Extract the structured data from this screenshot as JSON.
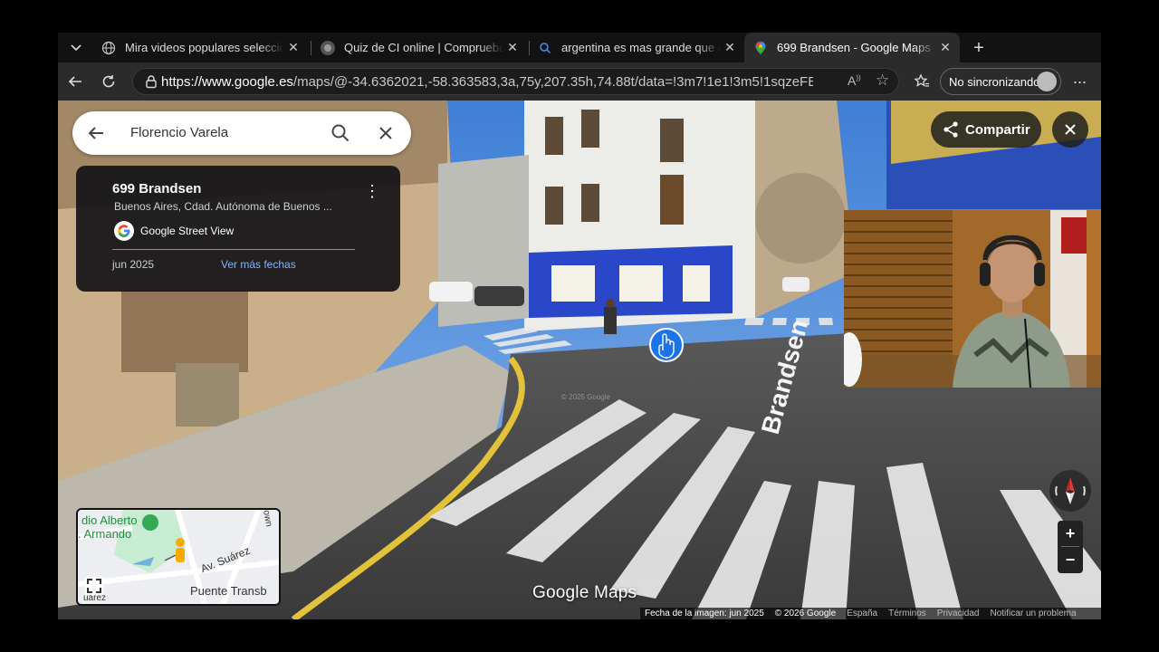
{
  "browser": {
    "tabs": [
      {
        "title": "Mira videos populares seleccion",
        "icon": "globe-icon",
        "active": false
      },
      {
        "title": "Quiz de CI online | Comprueba tu",
        "icon": "quiz-site-icon",
        "active": false
      },
      {
        "title": "argentina es mas grande que col",
        "icon": "search-icon",
        "active": false
      },
      {
        "title": "699 Brandsen - Google Maps",
        "icon": "google-maps-icon",
        "active": true
      }
    ],
    "address": {
      "host": "https://www.google.es",
      "path": "/maps/@-34.6362021,-58.363583,3a,75y,207.35h,74.88t/data=!3m7!1e1!3m5!1sqzeFEso-yQGRA..."
    },
    "sync_label": "No sincronizando"
  },
  "maps": {
    "search": {
      "query": "Florencio Varela"
    },
    "place": {
      "title": "699 Brandsen",
      "subtitle": "Buenos Aires, Cdad. Autónoma de Buenos ...",
      "source": "Google Street View",
      "date": "jun 2025",
      "more_dates": "Ver más fechas"
    },
    "share_label": "Compartir",
    "zoom": {
      "in": "+",
      "out": "−"
    },
    "minimap": {
      "labels": [
        "dio Alberto",
        ". Armando",
        "Av. Suárez",
        "Puente Transb",
        "own",
        "uarez"
      ]
    },
    "logo": "Google Maps",
    "street_label": "Brandsen",
    "watermark": "© 2025 Google",
    "footer": {
      "image_date": "Fecha de la imagen: jun 2025",
      "copyright": "© 2026 Google",
      "links": [
        "España",
        "Términos",
        "Privacidad",
        "Notificar un problema"
      ]
    }
  }
}
